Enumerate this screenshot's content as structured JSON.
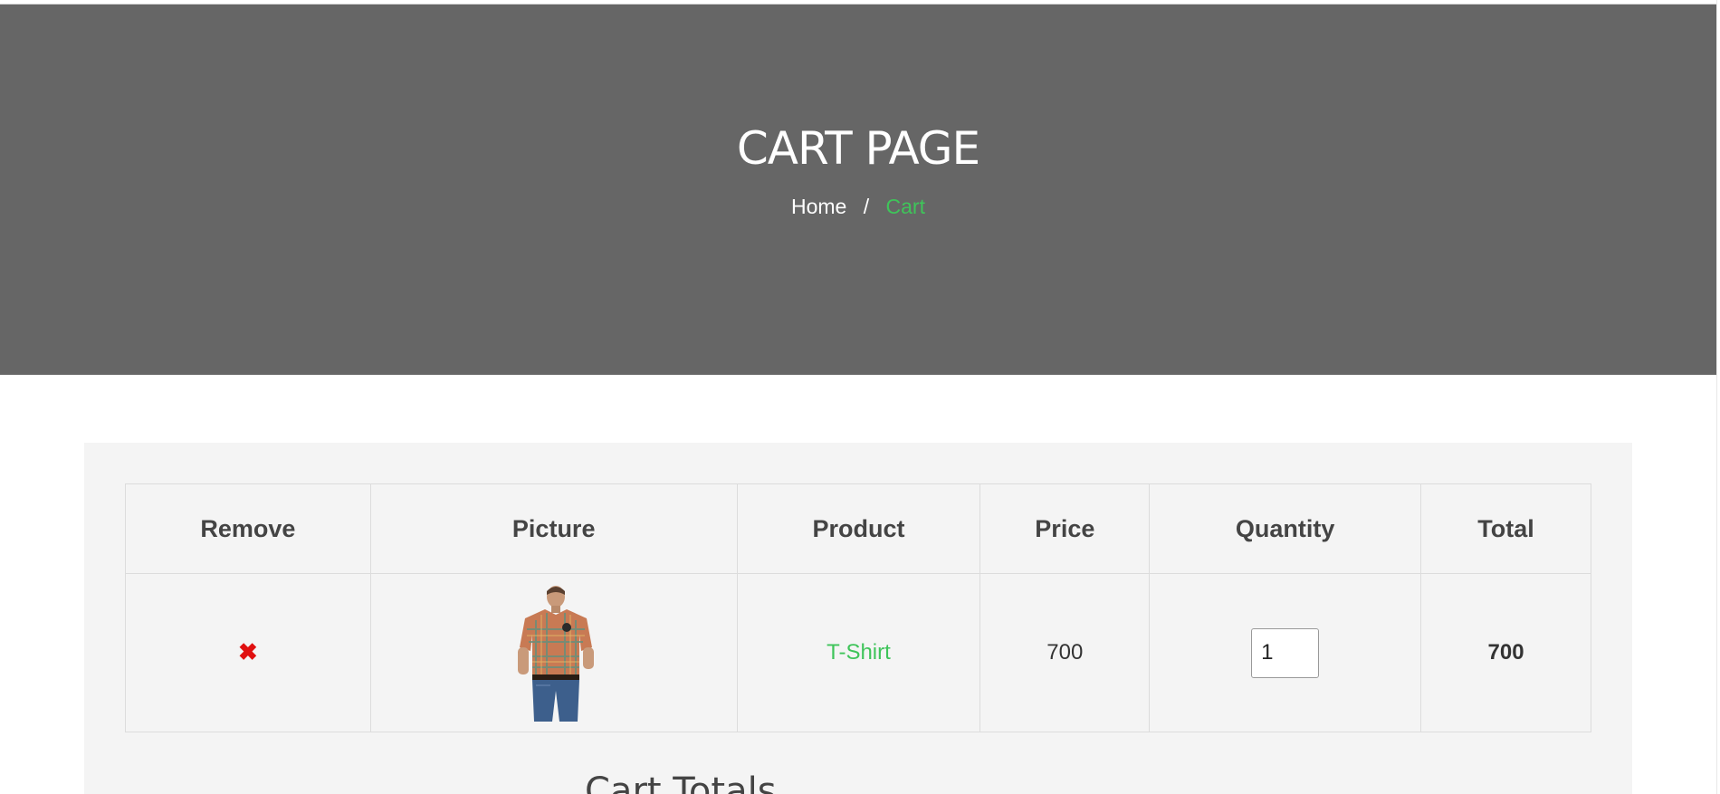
{
  "hero": {
    "title": "CART PAGE",
    "breadcrumb": {
      "home": "Home",
      "separator": "/",
      "current": "Cart"
    }
  },
  "cart": {
    "headers": [
      "Remove",
      "Picture",
      "Product",
      "Price",
      "Quantity",
      "Total"
    ],
    "rows": [
      {
        "remove_icon": "✖",
        "picture": "plaid-shirt-image",
        "product": "T-Shirt",
        "price": "700",
        "quantity": "1",
        "total": "700"
      }
    ]
  },
  "totals": {
    "title": "Cart Totals"
  },
  "colors": {
    "hero_bg": "#666666",
    "accent": "#3fc45a",
    "remove": "#e01010"
  }
}
